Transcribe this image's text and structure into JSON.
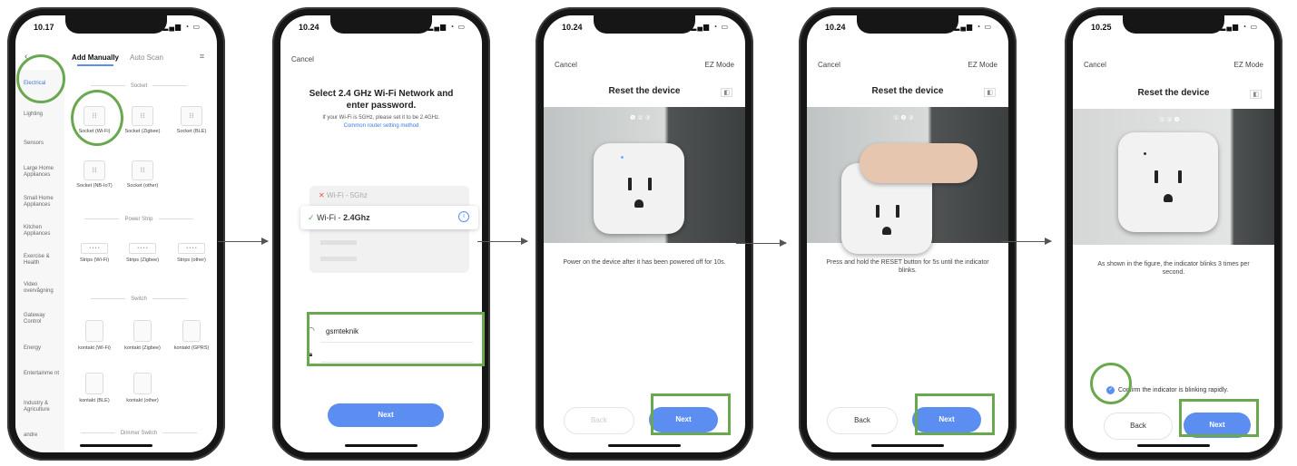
{
  "colors": {
    "highlight": "#6aa84f",
    "accent": "#5b8ef0",
    "link": "#3a7bd5"
  },
  "phone1": {
    "time": "10.17",
    "tabs": [
      "Add Manually",
      "Auto Scan"
    ],
    "sidebar": [
      "Electrical",
      "Lighting",
      "Sensors",
      "Large Home Appliances",
      "Small Home Appliances",
      "Kitchen Appliances",
      "Exercise & Health",
      "Video overvågning",
      "Gateway Control",
      "Energy",
      "Entertainme nt",
      "Industry & Agriculture",
      "andre"
    ],
    "sections": {
      "socket": "Socket",
      "power_strip": "Power Strip",
      "switch": "Switch",
      "dimmer": "Dimmer Switch"
    },
    "sockets": [
      "Socket (Wi-Fi)",
      "Socket (Zigbee)",
      "Socket (BLE)",
      "Socket (NB-IoT)",
      "Socket (other)"
    ],
    "strips": [
      "Strips (Wi-Fi)",
      "Strips (Zigbee)",
      "Strips (other)"
    ],
    "switches": [
      "kontakt (Wi-Fi)",
      "kontakt (Zigbee)",
      "kontakt (GPRS)",
      "kontakt (BLE)",
      "kontakt (other)"
    ]
  },
  "phone2": {
    "time": "10.24",
    "cancel": "Cancel",
    "title": "Select 2.4 GHz Wi-Fi Network and enter password.",
    "subtitle": "If your Wi-Fi is 5GHz, please set it to be 2.4GHz.",
    "link": "Common router setting method",
    "wifi_5": "Wi-Fi - 5Ghz",
    "wifi_24_prefix": "Wi-Fi - ",
    "wifi_24_band": "2.4Ghz",
    "network_name": "gsmteknik",
    "next": "Next"
  },
  "phone3": {
    "time": "10.24",
    "cancel": "Cancel",
    "mode": "EZ Mode",
    "title": "Reset the device",
    "caption": "Power on the device after it has been powered off for 10s.",
    "back": "Back",
    "next": "Next"
  },
  "phone4": {
    "time": "10.24",
    "cancel": "Cancel",
    "mode": "EZ Mode",
    "title": "Reset the device",
    "caption": "Press and hold the RESET button for 5s until the indicator blinks.",
    "back": "Back",
    "next": "Next"
  },
  "phone5": {
    "time": "10.25",
    "cancel": "Cancel",
    "mode": "EZ Mode",
    "title": "Reset the device",
    "caption": "As shown in the figure, the indicator blinks 3 times per second.",
    "confirm": "Confirm the indicator is blinking rapidly.",
    "back": "Back",
    "next": "Next"
  }
}
